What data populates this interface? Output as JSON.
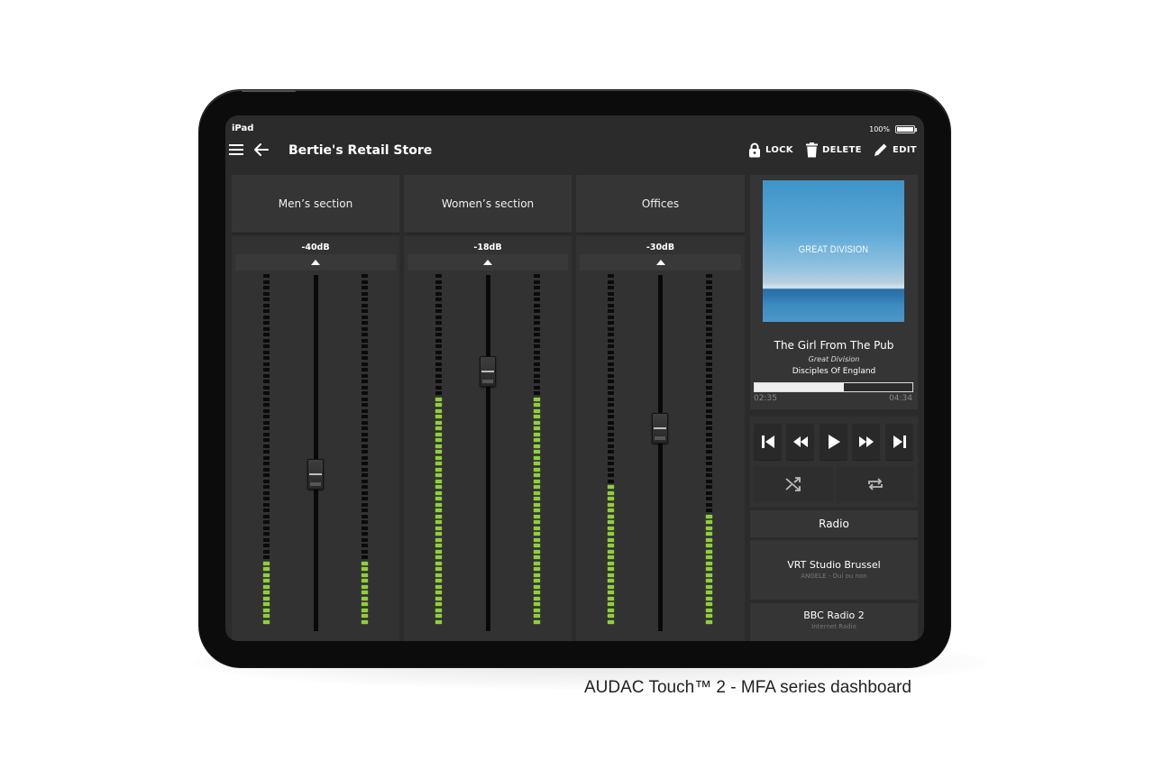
{
  "status_bar": {
    "device": "iPad",
    "battery": "100%"
  },
  "header": {
    "title": "Bertie's Retail Store",
    "menu_icon": "hamburger-icon",
    "back_icon": "arrow-left-icon",
    "actions": [
      {
        "label": "LOCK",
        "icon": "lock-icon"
      },
      {
        "label": "DELETE",
        "icon": "trash-icon"
      },
      {
        "label": "EDIT",
        "icon": "pencil-icon"
      }
    ]
  },
  "zones": [
    {
      "name": "Men’s section",
      "level": "-40dB",
      "fader_position": 0.44,
      "meter_left": 0.18,
      "meter_right": 0.18
    },
    {
      "name": "Women’s section",
      "level": "-18dB",
      "fader_position": 0.73,
      "meter_left": 0.65,
      "meter_right": 0.65
    },
    {
      "name": "Offices",
      "level": "-30dB",
      "fader_position": 0.57,
      "meter_left": 0.4,
      "meter_right": 0.31
    }
  ],
  "now_playing": {
    "album_art_text": "GREAT DIVISION",
    "title": "The Girl From The Pub",
    "artist": "Great Division",
    "album": "Disciples Of England",
    "elapsed": "02:35",
    "total": "04:34",
    "progress": 0.566
  },
  "transport": {
    "buttons": [
      "skip-previous-icon",
      "rewind-icon",
      "play-icon",
      "fast-forward-icon",
      "skip-next-icon"
    ],
    "secondary": [
      "shuffle-icon",
      "repeat-icon"
    ]
  },
  "radio": {
    "header": "Radio",
    "stations": [
      {
        "name": "VRT Studio Brussel",
        "subtitle": "ANGELE - Oui ou non"
      },
      {
        "name": "BBC Radio 2",
        "subtitle": "Internet Radio"
      }
    ]
  },
  "caption": "AUDAC Touch™ 2 - MFA series dashboard"
}
